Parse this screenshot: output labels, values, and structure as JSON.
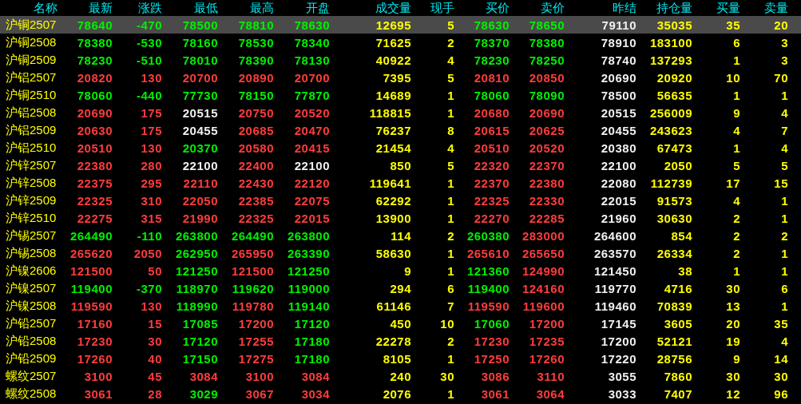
{
  "table": {
    "columns": [
      {
        "label": "名称",
        "kind": "name"
      },
      {
        "label": "最新",
        "kind": "price"
      },
      {
        "label": "涨跌",
        "kind": "change"
      },
      {
        "label": "最低",
        "kind": "price"
      },
      {
        "label": "最高",
        "kind": "price"
      },
      {
        "label": "开盘",
        "kind": "price"
      },
      {
        "label": "成交量",
        "kind": "qty"
      },
      {
        "label": "现手",
        "kind": "qty"
      },
      {
        "label": "买价",
        "kind": "price"
      },
      {
        "label": "卖价",
        "kind": "price"
      },
      {
        "label": "昨结",
        "kind": "ref"
      },
      {
        "label": "持仓量",
        "kind": "qty"
      },
      {
        "label": "买量",
        "kind": "qty"
      },
      {
        "label": "卖量",
        "kind": "qty"
      }
    ],
    "rows": [
      {
        "selected": true,
        "cells": [
          "沪铜2507",
          "78640",
          "-470",
          "78500",
          "78810",
          "78630",
          "12695",
          "5",
          "78630",
          "78650",
          "79110",
          "35035",
          "35",
          "20"
        ]
      },
      {
        "selected": false,
        "cells": [
          "沪铜2508",
          "78380",
          "-530",
          "78160",
          "78530",
          "78340",
          "71625",
          "2",
          "78370",
          "78380",
          "78910",
          "183100",
          "6",
          "3"
        ]
      },
      {
        "selected": false,
        "cells": [
          "沪铜2509",
          "78230",
          "-510",
          "78010",
          "78390",
          "78130",
          "40922",
          "4",
          "78230",
          "78250",
          "78740",
          "137293",
          "1",
          "3"
        ]
      },
      {
        "selected": false,
        "cells": [
          "沪铝2507",
          "20820",
          "130",
          "20700",
          "20890",
          "20700",
          "7395",
          "5",
          "20810",
          "20850",
          "20690",
          "20920",
          "10",
          "70"
        ]
      },
      {
        "selected": false,
        "cells": [
          "沪铜2510",
          "78060",
          "-440",
          "77730",
          "78150",
          "77870",
          "14689",
          "1",
          "78060",
          "78090",
          "78500",
          "56635",
          "1",
          "1"
        ]
      },
      {
        "selected": false,
        "cells": [
          "沪铝2508",
          "20690",
          "175",
          "20515",
          "20750",
          "20520",
          "118815",
          "1",
          "20680",
          "20690",
          "20515",
          "256009",
          "9",
          "4"
        ]
      },
      {
        "selected": false,
        "cells": [
          "沪铝2509",
          "20630",
          "175",
          "20455",
          "20685",
          "20470",
          "76237",
          "8",
          "20615",
          "20625",
          "20455",
          "243623",
          "4",
          "7"
        ]
      },
      {
        "selected": false,
        "cells": [
          "沪铝2510",
          "20510",
          "130",
          "20370",
          "20580",
          "20415",
          "21454",
          "4",
          "20510",
          "20520",
          "20380",
          "67473",
          "1",
          "4"
        ]
      },
      {
        "selected": false,
        "cells": [
          "沪锌2507",
          "22380",
          "280",
          "22100",
          "22400",
          "22100",
          "850",
          "5",
          "22320",
          "22370",
          "22100",
          "2050",
          "5",
          "5"
        ]
      },
      {
        "selected": false,
        "cells": [
          "沪锌2508",
          "22375",
          "295",
          "22110",
          "22430",
          "22120",
          "119641",
          "1",
          "22370",
          "22380",
          "22080",
          "112739",
          "17",
          "15"
        ]
      },
      {
        "selected": false,
        "cells": [
          "沪锌2509",
          "22325",
          "310",
          "22050",
          "22385",
          "22075",
          "62292",
          "1",
          "22325",
          "22330",
          "22015",
          "91573",
          "4",
          "1"
        ]
      },
      {
        "selected": false,
        "cells": [
          "沪锌2510",
          "22275",
          "315",
          "21990",
          "22325",
          "22015",
          "13900",
          "1",
          "22270",
          "22285",
          "21960",
          "30630",
          "2",
          "1"
        ]
      },
      {
        "selected": false,
        "cells": [
          "沪锡2507",
          "264490",
          "-110",
          "263800",
          "264490",
          "263800",
          "114",
          "2",
          "260380",
          "283000",
          "264600",
          "854",
          "2",
          "2"
        ]
      },
      {
        "selected": false,
        "cells": [
          "沪锡2508",
          "265620",
          "2050",
          "262950",
          "265950",
          "263390",
          "58630",
          "1",
          "265610",
          "265650",
          "263570",
          "26334",
          "2",
          "1"
        ]
      },
      {
        "selected": false,
        "cells": [
          "沪镍2606",
          "121500",
          "50",
          "121250",
          "121500",
          "121250",
          "9",
          "1",
          "121360",
          "124990",
          "121450",
          "38",
          "1",
          "1"
        ]
      },
      {
        "selected": false,
        "cells": [
          "沪镍2507",
          "119400",
          "-370",
          "118970",
          "119620",
          "119000",
          "294",
          "6",
          "119400",
          "124160",
          "119770",
          "4716",
          "30",
          "6"
        ]
      },
      {
        "selected": false,
        "cells": [
          "沪镍2508",
          "119590",
          "130",
          "118990",
          "119780",
          "119140",
          "61146",
          "7",
          "119590",
          "119600",
          "119460",
          "70839",
          "13",
          "1"
        ]
      },
      {
        "selected": false,
        "cells": [
          "沪铅2507",
          "17160",
          "15",
          "17085",
          "17200",
          "17120",
          "450",
          "10",
          "17060",
          "17200",
          "17145",
          "3605",
          "20",
          "35"
        ]
      },
      {
        "selected": false,
        "cells": [
          "沪铅2508",
          "17230",
          "30",
          "17120",
          "17255",
          "17180",
          "22278",
          "2",
          "17230",
          "17235",
          "17200",
          "52121",
          "19",
          "4"
        ]
      },
      {
        "selected": false,
        "cells": [
          "沪铅2509",
          "17260",
          "40",
          "17150",
          "17275",
          "17180",
          "8105",
          "1",
          "17250",
          "17260",
          "17220",
          "28756",
          "9",
          "14"
        ]
      },
      {
        "selected": false,
        "cells": [
          "螺纹2507",
          "3100",
          "45",
          "3084",
          "3100",
          "3084",
          "240",
          "30",
          "3086",
          "3110",
          "3055",
          "7860",
          "30",
          "30"
        ]
      },
      {
        "selected": false,
        "cells": [
          "螺纹2508",
          "3061",
          "28",
          "3029",
          "3067",
          "3034",
          "2076",
          "1",
          "3061",
          "3064",
          "3033",
          "7407",
          "12",
          "96"
        ]
      }
    ]
  }
}
